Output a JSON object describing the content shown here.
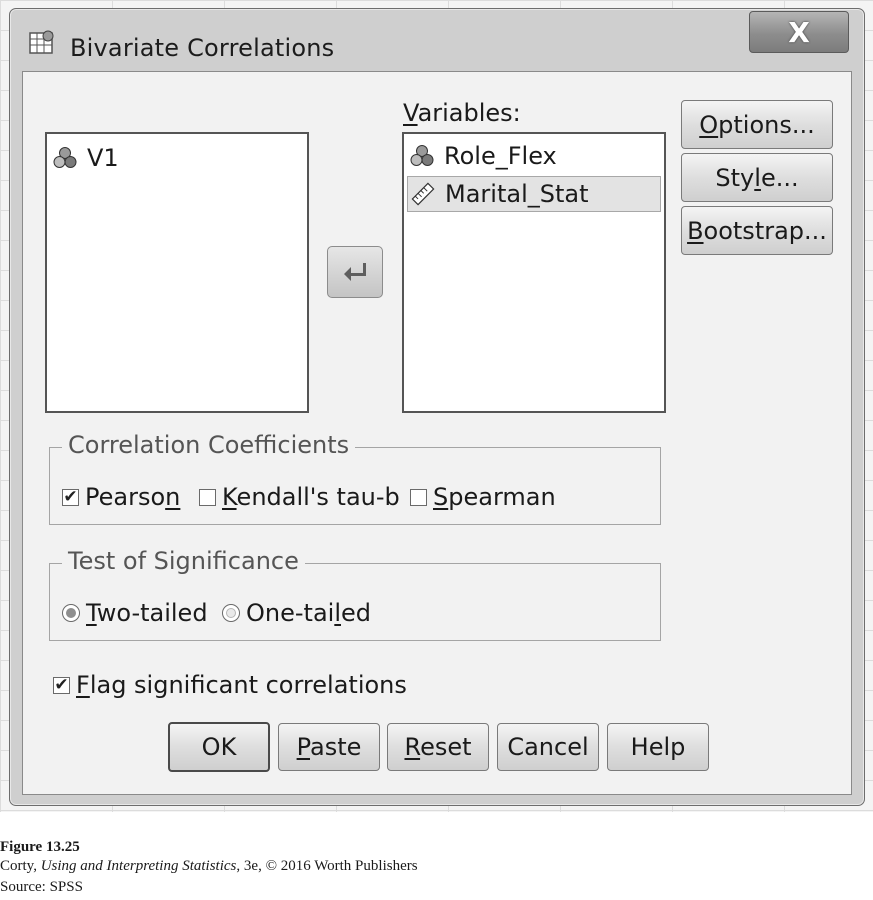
{
  "window": {
    "title": "Bivariate Correlations",
    "close_label": "X"
  },
  "source_list": {
    "items": [
      {
        "label": "V1",
        "icon": "nominal-icon"
      }
    ]
  },
  "variables": {
    "label": "Variables:",
    "label_mnemonic": "V",
    "label_rest": "ariables:",
    "items": [
      {
        "label": "Role_Flex",
        "icon": "nominal-icon"
      },
      {
        "label": "Marital_Stat",
        "icon": "scale-ruler-icon",
        "selected": true
      }
    ]
  },
  "side_buttons": {
    "options": {
      "label": "Options...",
      "mn": "O",
      "rest": "ptions..."
    },
    "style": {
      "label": "Style...",
      "pre": "Sty",
      "mn": "l",
      "rest": "e..."
    },
    "bootstrap": {
      "label": "Bootstrap...",
      "mn": "B",
      "rest": "ootstrap..."
    }
  },
  "correlation": {
    "title": "Correlation Coefficients",
    "pearson": {
      "label": "Pearson",
      "pre": "Pearso",
      "mn": "n",
      "rest": "",
      "checked": true
    },
    "kendall": {
      "label": "Kendall's tau-b",
      "mn": "K",
      "rest": "endall's tau-b",
      "checked": false
    },
    "spearman": {
      "label": "Spearman",
      "mn": "S",
      "rest": "pearman",
      "checked": false
    }
  },
  "significance": {
    "title": "Test of Significance",
    "two_tailed": {
      "label": "Two-tailed",
      "mn": "T",
      "rest": "wo-tailed",
      "selected": true
    },
    "one_tailed": {
      "label": "One-tailed",
      "pre": "One-tai",
      "mn": "l",
      "rest": "ed",
      "selected": false
    }
  },
  "flag": {
    "label": "Flag significant correlations",
    "mn": "F",
    "rest": "lag significant correlations",
    "checked": true
  },
  "footer_buttons": {
    "ok": "OK",
    "paste": {
      "label": "Paste",
      "mn": "P",
      "rest": "aste"
    },
    "reset": {
      "label": "Reset",
      "mn": "R",
      "rest": "eset"
    },
    "cancel": "Cancel",
    "help": "Help"
  },
  "caption": {
    "figure": "Figure 13.25",
    "credit_author": "Corty, ",
    "credit_title": "Using and Interpreting Statistics",
    "credit_rest": ", 3e, © 2016 Worth Publishers",
    "source": "Source: SPSS"
  },
  "colors": {
    "dialog_bg": "#f2f2f2",
    "frame": "#cfcfcf",
    "selection": "#e3e3e3"
  }
}
